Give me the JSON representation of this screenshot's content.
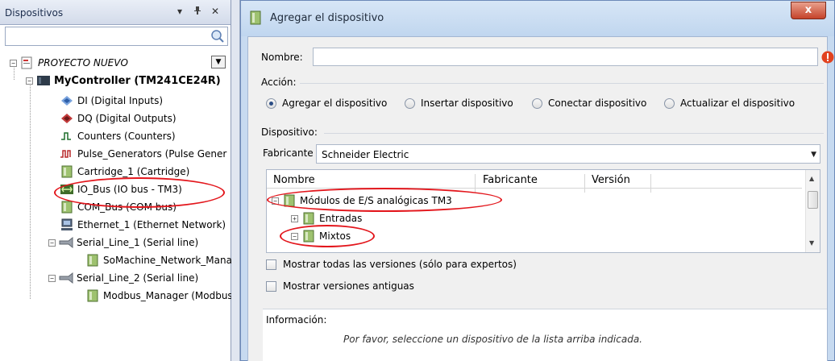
{
  "devices_panel": {
    "title": "Dispositivos",
    "pin_glyph": "▾",
    "pin2_glyph": "ᵖ",
    "close_glyph": "✕",
    "search_placeholder": "",
    "tree": {
      "project": "PROYECTO NUEVO",
      "controller": "MyController (TM241CE24R)",
      "items": [
        "DI (Digital Inputs)",
        "DQ (Digital Outputs)",
        "Counters (Counters)",
        "Pulse_Generators (Pulse Gener",
        "Cartridge_1 (Cartridge)",
        "IO_Bus (IO bus - TM3)",
        "COM_Bus (COM bus)",
        "Ethernet_1 (Ethernet Network)",
        "Serial_Line_1 (Serial line)",
        "SoMachine_Network_Mana",
        "Serial_Line_2 (Serial line)",
        "Modbus_Manager (Modbus"
      ]
    }
  },
  "dialog": {
    "title": "Agregar el dispositivo",
    "close_label": "x",
    "name_label": "Nombre:",
    "name_value": "",
    "action_label": "Acción:",
    "actions": [
      {
        "label": "Agregar el dispositivo",
        "selected": true
      },
      {
        "label": "Insertar dispositivo",
        "selected": false
      },
      {
        "label": "Conectar dispositivo",
        "selected": false
      },
      {
        "label": "Actualizar el dispositivo",
        "selected": false
      }
    ],
    "device_label": "Dispositivo:",
    "manufacturer_label": "Fabricante",
    "manufacturer_value": "Schneider Electric",
    "columns": [
      "Nombre",
      "Fabricante",
      "Versión"
    ],
    "list": {
      "group": "Módulos de E/S analógicas TM3",
      "child1": "Entradas",
      "child2": "Mixtos"
    },
    "show_all_versions": "Mostrar todas las versiones (sólo para expertos)",
    "show_old_versions": "Mostrar versiones antiguas",
    "info_label": "Información:",
    "info_text": "Por favor, seleccione un dispositivo de la lista arriba indicada."
  },
  "colors": {
    "annotation": "#e3161c",
    "close_button": "#c5432a",
    "accent": "#2b4d85"
  }
}
